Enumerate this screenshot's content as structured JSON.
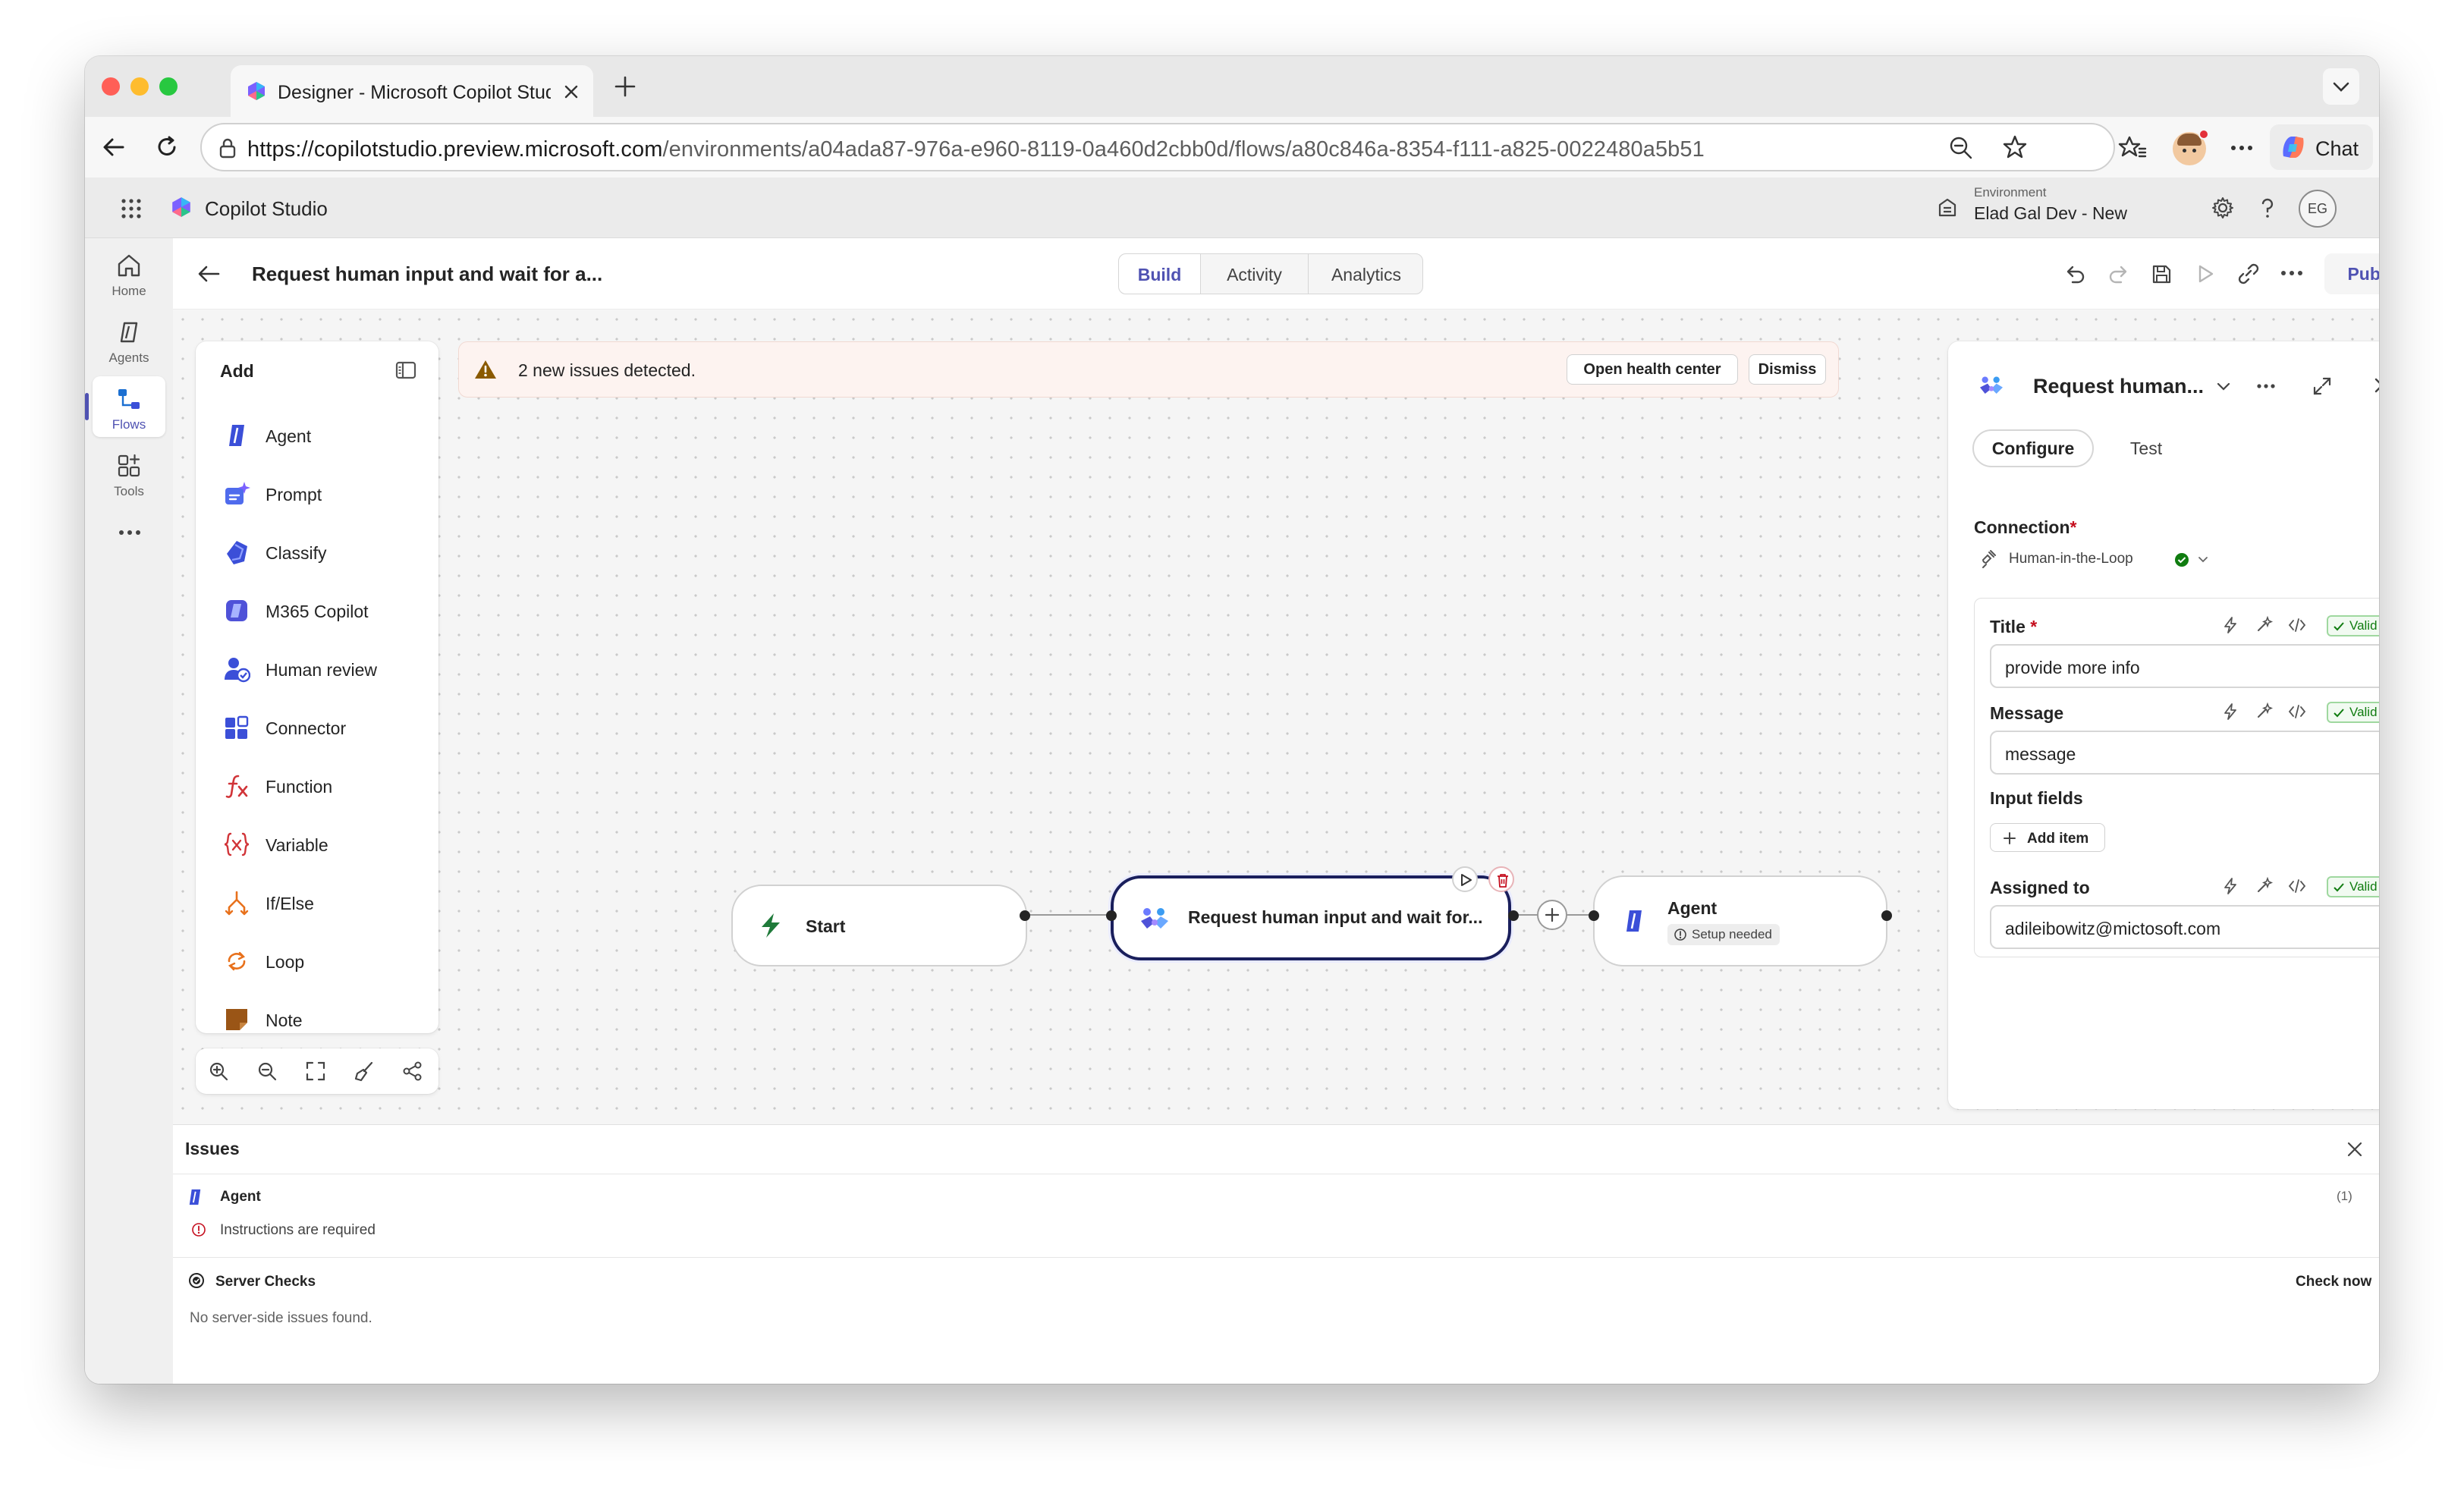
{
  "browser": {
    "tab_title": "Designer - Microsoft Copilot Studio",
    "url_host": "https://copilotstudio.preview.microsoft.com",
    "url_path": "/environments/a04ada87-976a-e960-8119-0a460d2cbb0d/flows/a80c846a-8354-f111-a825-0022480a5b51",
    "chat_label": "Chat"
  },
  "app": {
    "name": "Copilot Studio",
    "environment_label": "Environment",
    "environment_name": "Elad Gal Dev - New",
    "user_initials": "EG"
  },
  "rail": {
    "items": [
      {
        "label": "Home",
        "icon": "home-icon"
      },
      {
        "label": "Agents",
        "icon": "agents-icon"
      },
      {
        "label": "Flows",
        "icon": "flows-icon",
        "active": true
      },
      {
        "label": "Tools",
        "icon": "tools-icon"
      }
    ]
  },
  "command_bar": {
    "title": "Request human input and wait for a...",
    "tabs": [
      "Build",
      "Activity",
      "Analytics"
    ],
    "active_tab": "Build",
    "publish_label": "Publish"
  },
  "add_panel": {
    "title": "Add",
    "items": [
      {
        "label": "Agent",
        "icon": "agent-icon"
      },
      {
        "label": "Prompt",
        "icon": "prompt-icon"
      },
      {
        "label": "Classify",
        "icon": "classify-icon"
      },
      {
        "label": "M365 Copilot",
        "icon": "m365-copilot-icon"
      },
      {
        "label": "Human review",
        "icon": "human-review-icon"
      },
      {
        "label": "Connector",
        "icon": "connector-icon"
      },
      {
        "label": "Function",
        "icon": "function-icon"
      },
      {
        "label": "Variable",
        "icon": "variable-icon"
      },
      {
        "label": "If/Else",
        "icon": "if-else-icon"
      },
      {
        "label": "Loop",
        "icon": "loop-icon"
      },
      {
        "label": "Note",
        "icon": "note-icon"
      }
    ]
  },
  "banner": {
    "message": "2 new issues detected.",
    "open_health_center": "Open health center",
    "dismiss": "Dismiss"
  },
  "flow": {
    "nodes": [
      {
        "label": "Start"
      },
      {
        "label": "Request human input and wait for..."
      },
      {
        "label": "Agent",
        "status": "Setup needed"
      }
    ]
  },
  "props_panel": {
    "title": "Request human...",
    "tabs": [
      "Configure",
      "Test"
    ],
    "active_tab": "Configure",
    "connection_label": "Connection",
    "connection_value": "Human-in-the-Loop",
    "title_label": "Title",
    "title_value": "provide more info",
    "message_label": "Message",
    "message_value": "message",
    "input_fields_label": "Input fields",
    "add_item_label": "Add item",
    "assigned_to_label": "Assigned to",
    "assigned_to_value": "adileibowitz@mictosoft.com",
    "valid_label": "Valid",
    "required_mark": "*"
  },
  "issues": {
    "title": "Issues",
    "agent_label": "Agent",
    "agent_count": "(1)",
    "agent_issue": "Instructions are required",
    "server_checks_label": "Server Checks",
    "check_now_label": "Check now",
    "server_status": "No server-side issues found."
  },
  "colors": {
    "accent": "#4f52b2",
    "brand_blue": "#3b4fd8",
    "warning_bg": "#fdf3f0",
    "valid_green": "#107c10",
    "error_red": "#c50f1f"
  }
}
